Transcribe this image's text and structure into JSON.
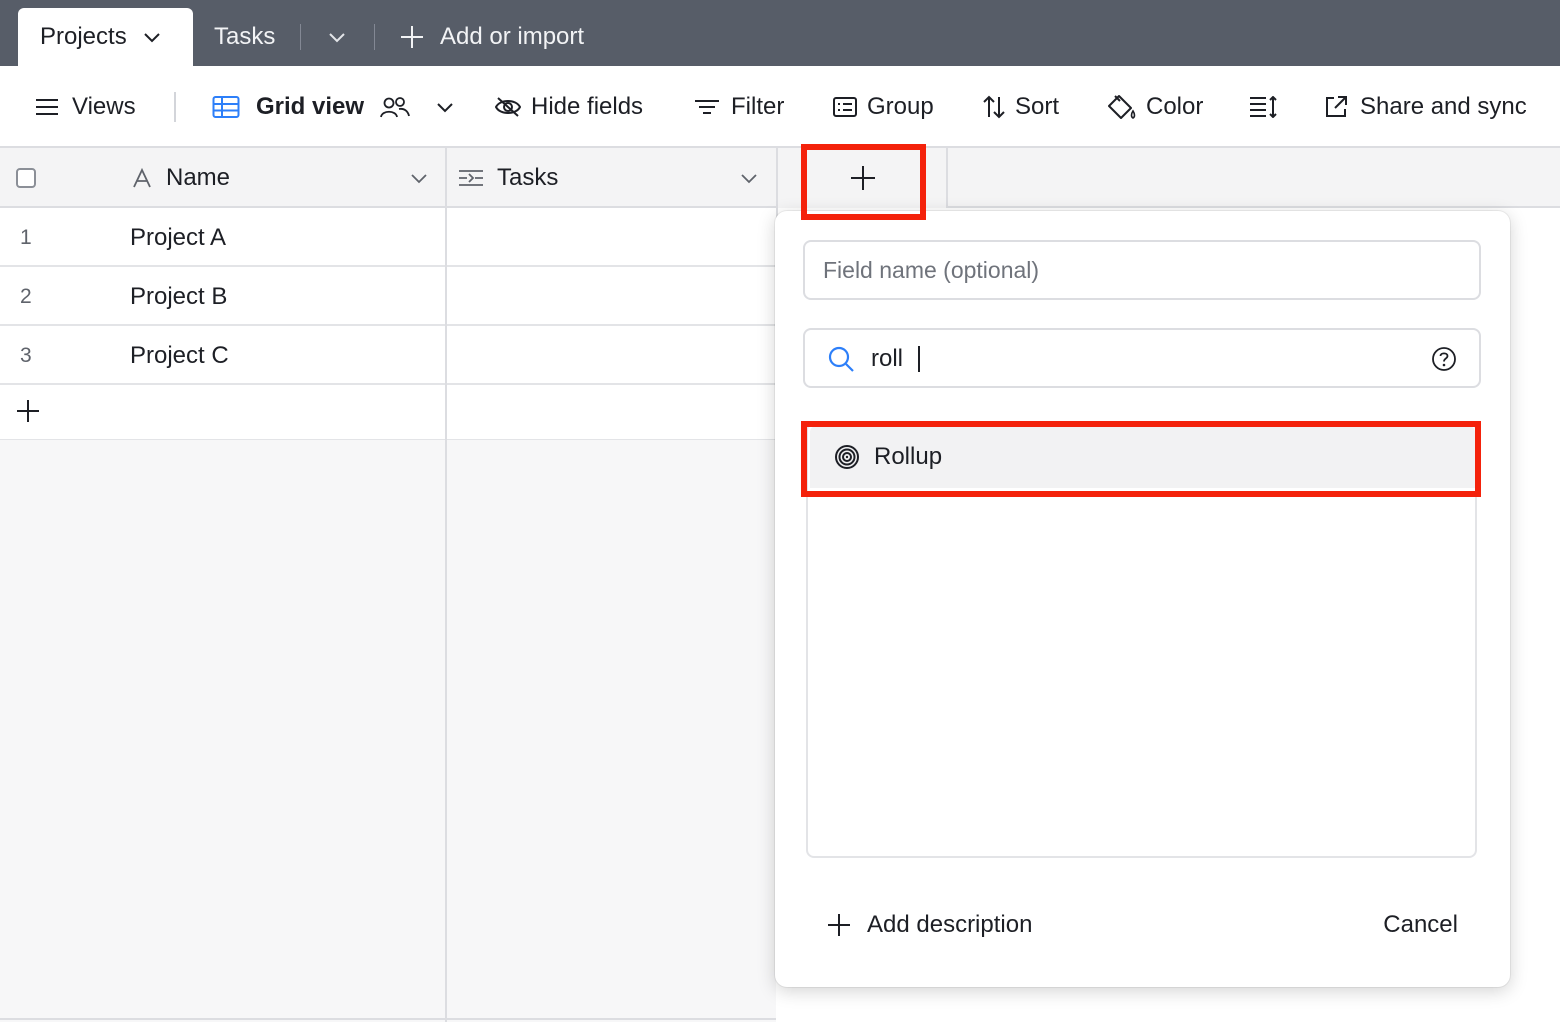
{
  "tabs": {
    "active": "Projects",
    "second": "Tasks",
    "add_import": "Add or import"
  },
  "toolbar": {
    "views": "Views",
    "grid_view": "Grid view",
    "hide_fields": "Hide fields",
    "filter": "Filter",
    "group": "Group",
    "sort": "Sort",
    "color": "Color",
    "share": "Share and sync"
  },
  "grid": {
    "columns": [
      "Name",
      "Tasks"
    ],
    "rows": [
      {
        "num": "1",
        "name": "Project A"
      },
      {
        "num": "2",
        "name": "Project B"
      },
      {
        "num": "3",
        "name": "Project C"
      }
    ]
  },
  "popover": {
    "field_name_placeholder": "Field name (optional)",
    "search_value": "roll",
    "result_item": "Rollup",
    "add_description": "Add description",
    "cancel": "Cancel"
  },
  "colors": {
    "tabbar": "#575d68",
    "highlight": "#f4220b",
    "accent_blue": "#2d7ff9"
  }
}
